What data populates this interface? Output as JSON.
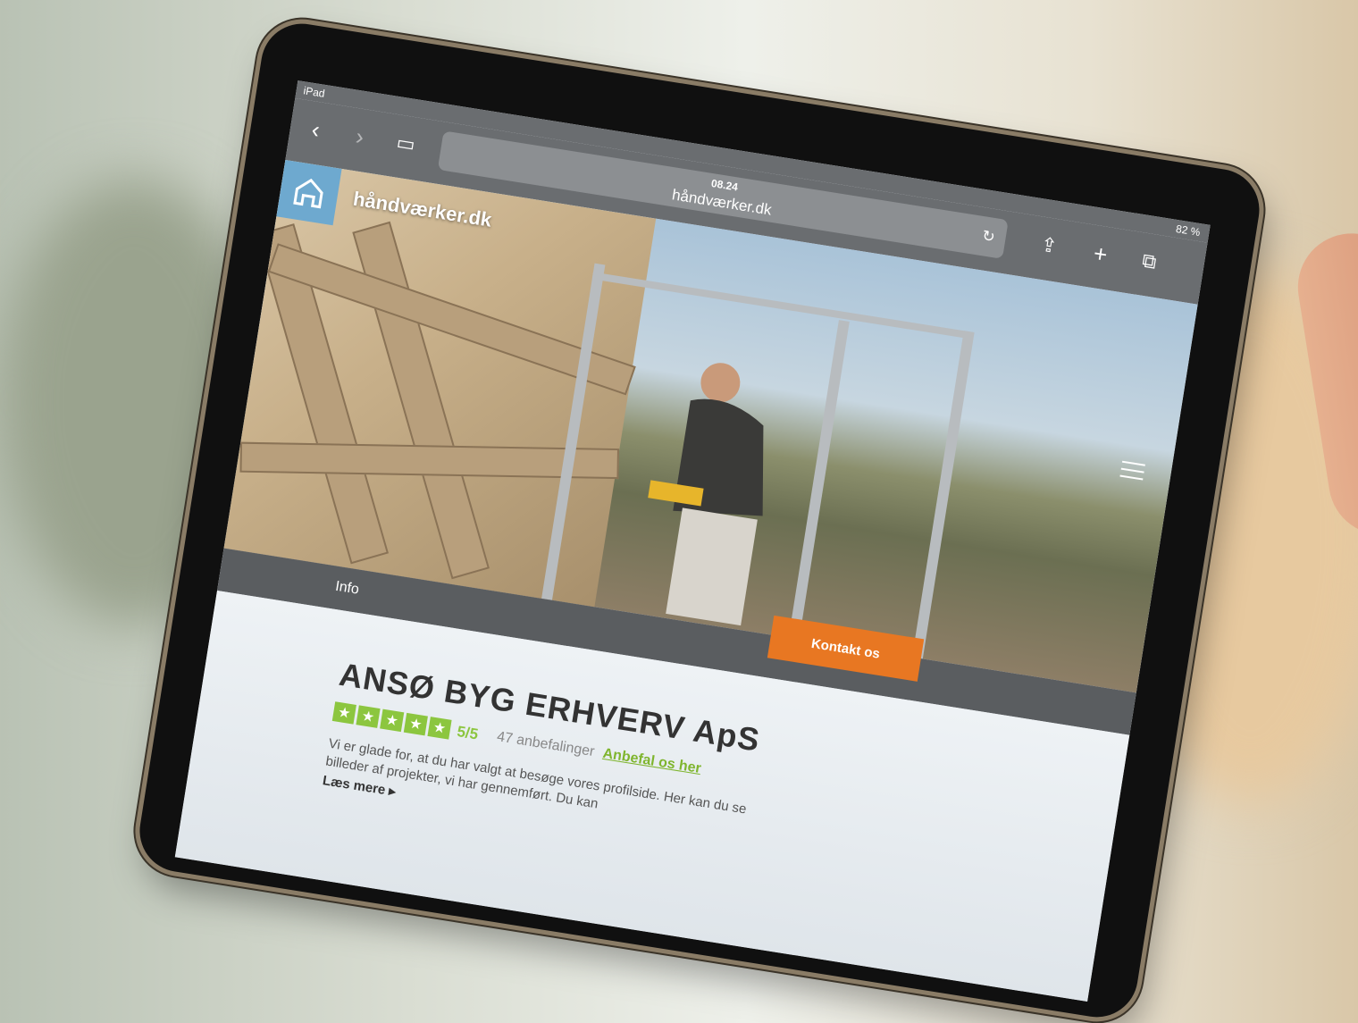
{
  "status": {
    "device": "iPad",
    "battery": "82 %"
  },
  "browser": {
    "time": "08.24",
    "url": "håndværker.dk"
  },
  "site": {
    "brand": "håndværker.dk",
    "nav_info": "Info",
    "contact_button": "Kontakt os"
  },
  "profile": {
    "company": "ANSØ BYG ERHVERV ApS",
    "score": "5/5",
    "reviews": "47 anbefalinger",
    "recommend_link": "Anbefal os her",
    "description": "Vi er glade for, at du har valgt at besøge vores profilside. Her kan du se billeder af projekter, vi har gennemført. Du kan",
    "read_more": "Læs mere"
  },
  "colors": {
    "accent": "#e87722",
    "rating": "#8cc63f",
    "brand_blue": "#6ea9cf"
  }
}
